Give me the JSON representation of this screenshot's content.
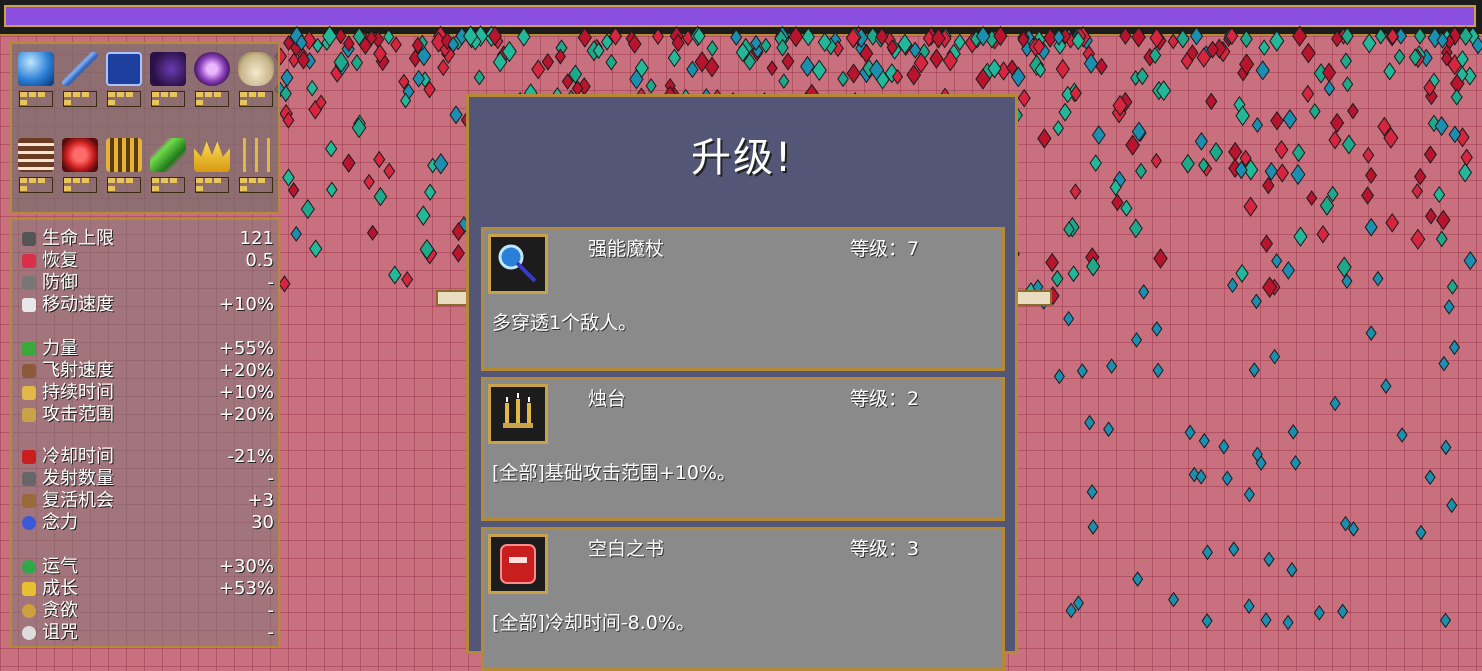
{
  "levelup": {
    "title": "升级!",
    "options": [
      {
        "name": "强能魔杖",
        "level": "等级：7",
        "description": "多穿透1个敌人。",
        "icon": "magic-wand-icon"
      },
      {
        "name": "烛台",
        "level": "等级：2",
        "description": "[全部]基础攻击范围+10%。",
        "icon": "candelabra-icon"
      },
      {
        "name": "空白之书",
        "level": "等级：3",
        "description": "[全部]冷却时间-8.0%。",
        "icon": "empty-tome-icon"
      }
    ]
  },
  "inventory": {
    "weapons": [
      "magic-wand-icon",
      "whip-icon",
      "king-bible-icon",
      "peachone-icon",
      "runetracer-icon",
      "garlic-icon"
    ],
    "passives": [
      "hollow-heart-icon",
      "empty-tome-icon",
      "spellbinder-icon",
      "pummarola-icon",
      "crown-icon",
      "candelabra-icon"
    ]
  },
  "stats": [
    {
      "label": "生命上限",
      "value": "121",
      "icon": "heart-icon"
    },
    {
      "label": "恢复",
      "value": "0.5",
      "icon": "recovery-icon"
    },
    {
      "label": "防御",
      "value": "-",
      "icon": "armor-icon"
    },
    {
      "label": "移动速度",
      "value": "+10%",
      "icon": "wings-icon"
    },
    {
      "label": "力量",
      "value": "+55%",
      "icon": "spinach-icon"
    },
    {
      "label": "飞射速度",
      "value": "+20%",
      "icon": "bracer-icon"
    },
    {
      "label": "持续时间",
      "value": "+10%",
      "icon": "spellbinder-icon"
    },
    {
      "label": "攻击范围",
      "value": "+20%",
      "icon": "candelabra-icon"
    },
    {
      "label": "冷却时间",
      "value": "-21%",
      "icon": "empty-tome-icon"
    },
    {
      "label": "发射数量",
      "value": "-",
      "icon": "duplicator-icon"
    },
    {
      "label": "复活机会",
      "value": "+3",
      "icon": "revival-icon"
    },
    {
      "label": "念力",
      "value": "30",
      "icon": "attractorb-icon"
    },
    {
      "label": "运气",
      "value": "+30%",
      "icon": "clover-icon"
    },
    {
      "label": "成长",
      "value": "+53%",
      "icon": "crown-icon"
    },
    {
      "label": "贪欲",
      "value": "-",
      "icon": "greed-icon"
    },
    {
      "label": "诅咒",
      "value": "-",
      "icon": "curse-icon"
    }
  ],
  "colors": {
    "xp": "#8a4fe0",
    "frame": "#b58a36",
    "panel": "#545677",
    "card": "#8a8a8a"
  }
}
